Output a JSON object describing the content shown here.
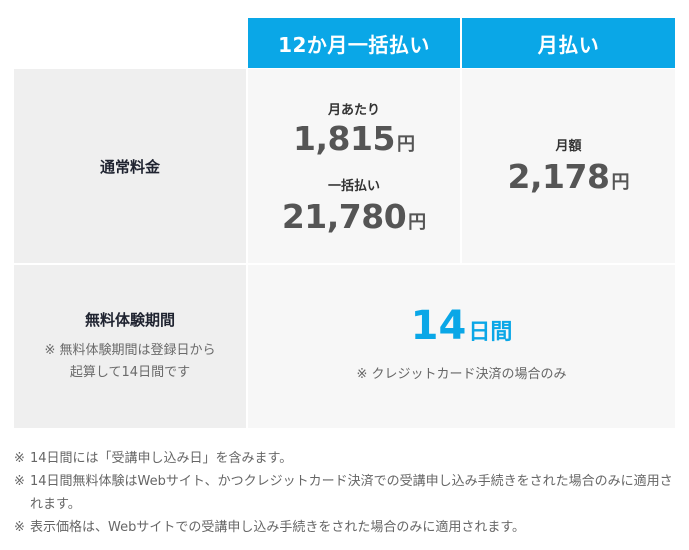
{
  "table": {
    "header": {
      "plan_annual": "12か月一括払い",
      "plan_monthly": "月払い"
    },
    "row_regular": {
      "label": "通常料金",
      "annual": {
        "per_month_label": "月あたり",
        "per_month_value": "1,815",
        "lump_sum_label": "一括払い",
        "lump_sum_value": "21,780",
        "currency": "円"
      },
      "monthly": {
        "label": "月額",
        "value": "2,178",
        "currency": "円"
      }
    },
    "row_trial": {
      "label": "無料体験期間",
      "note_line1": "※ 無料体験期間は登録日から",
      "note_line2": "起算して14日間です",
      "trial_days": "14",
      "trial_unit": "日間",
      "trial_note": "※ クレジットカード決済の場合のみ"
    }
  },
  "footnotes": [
    {
      "mark": "※",
      "text": "14日間には「受講申し込み日」を含みます。"
    },
    {
      "mark": "※",
      "text": "14日間無料体験はWebサイト、かつクレジットカード決済での受講申し込み手続きをされた場合のみに適用されます。"
    },
    {
      "mark": "※",
      "text": "表示価格は、Webサイトでの受講申し込み手続きをされた場合のみに適用されます。"
    }
  ],
  "colors": {
    "header_bg": "#0aa7e7",
    "accent_text": "#0aa7e7",
    "label_bg": "#efefef",
    "cell_bg": "#f7f7f7"
  }
}
